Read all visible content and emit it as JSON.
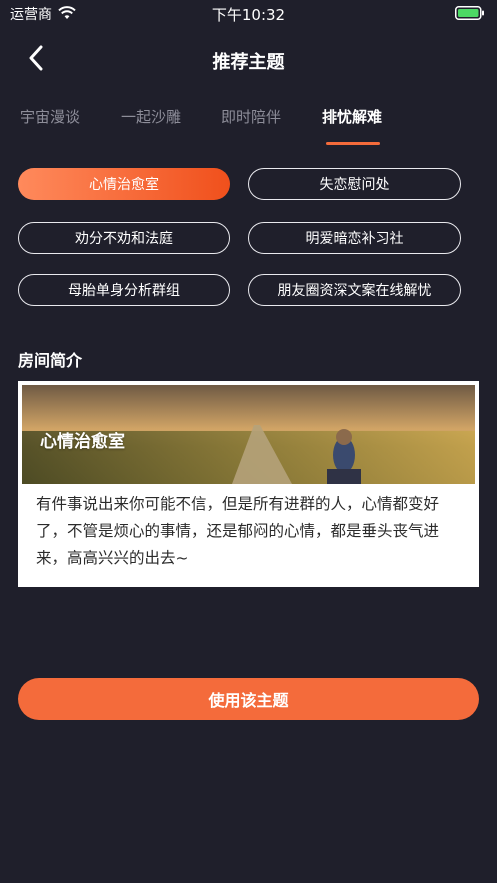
{
  "status_bar": {
    "carrier": "运营商",
    "time": "下午10:32"
  },
  "nav": {
    "title": "推荐主题"
  },
  "tabs": [
    {
      "label": "宇宙漫谈"
    },
    {
      "label": "一起沙雕"
    },
    {
      "label": "即时陪伴"
    },
    {
      "label": "排忧解难"
    }
  ],
  "topics": [
    {
      "label": "心情治愈室"
    },
    {
      "label": "失恋慰问处"
    },
    {
      "label": "劝分不劝和法庭"
    },
    {
      "label": "明爱暗恋补习社"
    },
    {
      "label": "母胎单身分析群组"
    },
    {
      "label": "朋友圈资深文案在线解忧"
    }
  ],
  "section": {
    "label": "房间简介"
  },
  "room_card": {
    "image_title": "心情治愈室",
    "description": "有件事说出来你可能不信，但是所有进群的人，心情都变好了，不管是烦心的事情，还是郁闷的心情，都是垂头丧气进来，高高兴兴的出去~"
  },
  "action": {
    "use_label": "使用该主题"
  },
  "colors": {
    "accent": "#f46b3b",
    "background": "#1f1f2b"
  }
}
